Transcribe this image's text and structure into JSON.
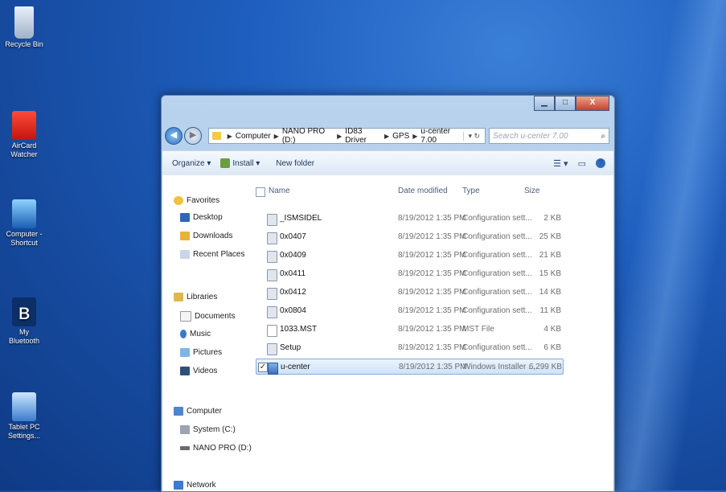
{
  "desktop": {
    "icons": [
      {
        "label": "Recycle Bin",
        "icon": "recycle-bin-icon"
      },
      {
        "label": "AirCard Watcher",
        "icon": "aircard-icon"
      },
      {
        "label": "Computer - Shortcut",
        "icon": "computer-shortcut-icon"
      },
      {
        "label": "My Bluetooth",
        "icon": "bluetooth-icon"
      },
      {
        "label": "Tablet PC Settings...",
        "icon": "tablet-settings-icon"
      }
    ]
  },
  "window": {
    "controls": {
      "minimize": "▁",
      "maximize": "□",
      "close": "X"
    },
    "breadcrumbs": [
      "Computer",
      "NANO PRO (D:)",
      "ID83 Driver",
      "GPS",
      "u-center 7.00"
    ],
    "search_placeholder": "Search u-center 7.00",
    "toolbar": {
      "organize": "Organize ▾",
      "install": "Install ▾",
      "new_folder": "New folder",
      "views": "☰ ▾",
      "preview": "▭",
      "help": "?"
    },
    "nav": {
      "favorites": "Favorites",
      "desktop": "Desktop",
      "downloads": "Downloads",
      "recent_places": "Recent Places",
      "libraries": "Libraries",
      "documents": "Documents",
      "music": "Music",
      "pictures": "Pictures",
      "videos": "Videos",
      "computer": "Computer",
      "system_c": "System (C:)",
      "nano_pro": "NANO PRO (D:)",
      "network": "Network"
    },
    "columns": {
      "name": "Name",
      "date": "Date modified",
      "type": "Type",
      "size": "Size"
    },
    "files": [
      {
        "name": "_ISMSIDEL",
        "date": "8/19/2012 1:35 PM",
        "type": "Configuration sett...",
        "size": "2 KB"
      },
      {
        "name": "0x0407",
        "date": "8/19/2012 1:35 PM",
        "type": "Configuration sett...",
        "size": "25 KB"
      },
      {
        "name": "0x0409",
        "date": "8/19/2012 1:35 PM",
        "type": "Configuration sett...",
        "size": "21 KB"
      },
      {
        "name": "0x0411",
        "date": "8/19/2012 1:35 PM",
        "type": "Configuration sett...",
        "size": "15 KB"
      },
      {
        "name": "0x0412",
        "date": "8/19/2012 1:35 PM",
        "type": "Configuration sett...",
        "size": "14 KB"
      },
      {
        "name": "0x0804",
        "date": "8/19/2012 1:35 PM",
        "type": "Configuration sett...",
        "size": "11 KB"
      },
      {
        "name": "1033.MST",
        "date": "8/19/2012 1:35 PM",
        "type": "MST File",
        "size": "4 KB"
      },
      {
        "name": "Setup",
        "date": "8/19/2012 1:35 PM",
        "type": "Configuration sett...",
        "size": "6 KB"
      },
      {
        "name": "u-center",
        "date": "8/19/2012 1:35 PM",
        "type": "Windows Installer ...",
        "size": "6,299 KB"
      }
    ],
    "selected_check": "✓"
  }
}
